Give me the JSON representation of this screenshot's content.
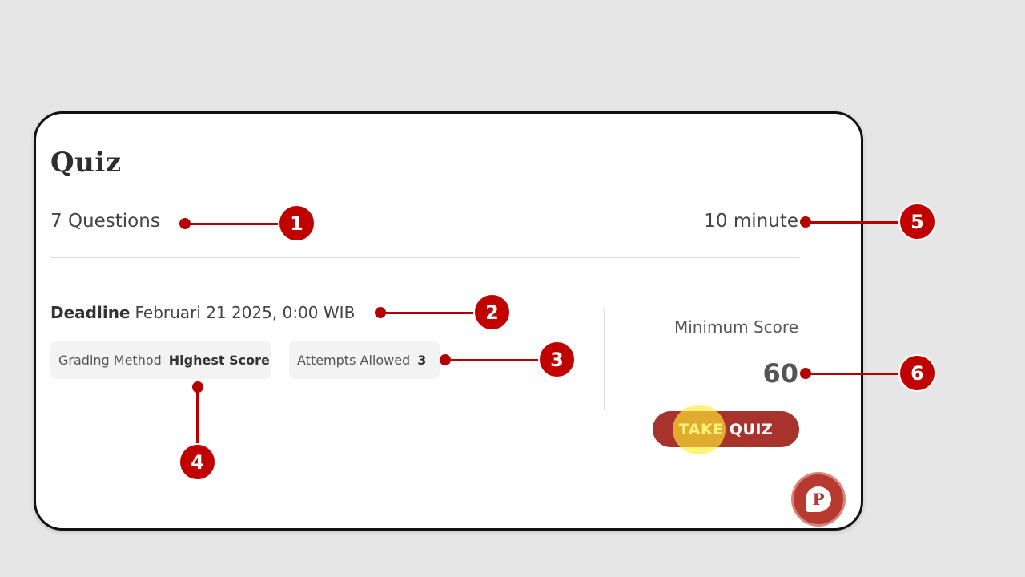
{
  "quiz": {
    "title": "Quiz",
    "questions": "7 Questions",
    "duration": "10 minute",
    "deadline_label": "Deadline",
    "deadline_value": "Februari 21 2025, 0:00 WIB",
    "grading_label": "Grading Method",
    "grading_value": "Highest Score",
    "attempts_label": "Attempts Allowed",
    "attempts_value": "3",
    "min_score_label": "Minimum Score",
    "min_score_value": "60",
    "take_quiz_label": "TAKE QUIZ"
  },
  "chat_fab": {
    "glyph": "P",
    "icon": "chat-bubble-icon"
  },
  "annotations": [
    "1",
    "2",
    "3",
    "4",
    "5",
    "6"
  ],
  "colors": {
    "accent": "#a8322c",
    "annotation": "#c10000",
    "highlight": "#ffec32"
  }
}
